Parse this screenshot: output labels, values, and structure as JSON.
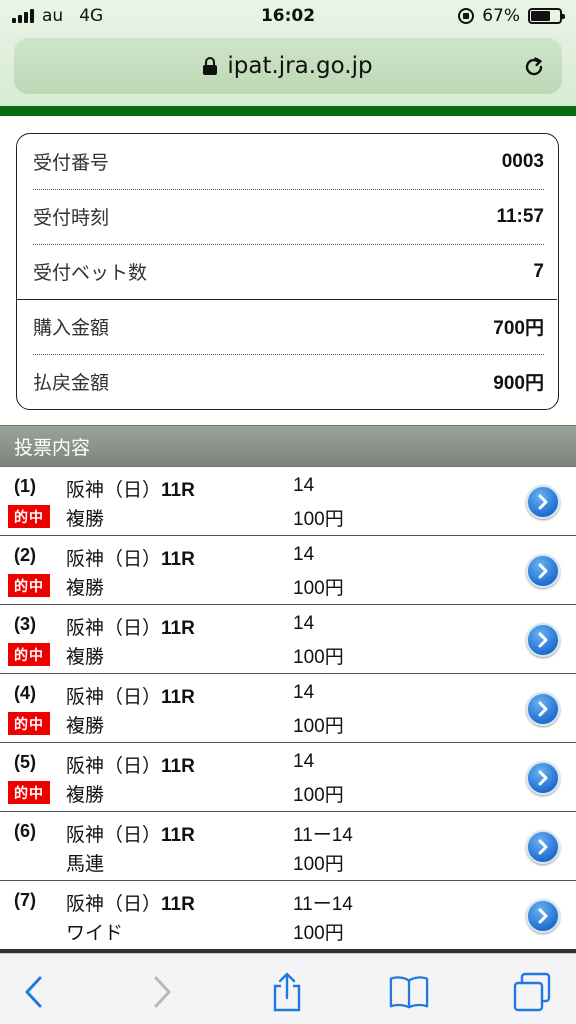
{
  "status": {
    "carrier": "au",
    "network": "4G",
    "time": "16:02",
    "battery": "67%",
    "battery_level": 0.67
  },
  "browser": {
    "url": "ipat.jra.go.jp"
  },
  "receipt": {
    "rows": [
      {
        "label": "受付番号",
        "value": "0003"
      },
      {
        "label": "受付時刻",
        "value": "11:57"
      },
      {
        "label": "受付ベット数",
        "value": "7"
      },
      {
        "label": "購入金額",
        "value": "700円"
      },
      {
        "label": "払戻金額",
        "value": "900円"
      }
    ]
  },
  "section": {
    "title": "投票内容"
  },
  "bets": [
    {
      "num": "(1)",
      "venue": "阪神（日）",
      "race": "11R",
      "type": "複勝",
      "horse": "14",
      "amount": "100円",
      "badge": "的中"
    },
    {
      "num": "(2)",
      "venue": "阪神（日）",
      "race": "11R",
      "type": "複勝",
      "horse": "14",
      "amount": "100円",
      "badge": "的中"
    },
    {
      "num": "(3)",
      "venue": "阪神（日）",
      "race": "11R",
      "type": "複勝",
      "horse": "14",
      "amount": "100円",
      "badge": "的中"
    },
    {
      "num": "(4)",
      "venue": "阪神（日）",
      "race": "11R",
      "type": "複勝",
      "horse": "14",
      "amount": "100円",
      "badge": "的中"
    },
    {
      "num": "(5)",
      "venue": "阪神（日）",
      "race": "11R",
      "type": "複勝",
      "horse": "14",
      "amount": "100円",
      "badge": "的中"
    },
    {
      "num": "(6)",
      "venue": "阪神（日）",
      "race": "11R",
      "type": "馬連",
      "horse": "11ー14",
      "amount": "100円",
      "badge": ""
    },
    {
      "num": "(7)",
      "venue": "阪神（日）",
      "race": "11R",
      "type": "ワイド",
      "horse": "11ー14",
      "amount": "100円",
      "badge": ""
    }
  ],
  "colors": {
    "accent_green": "#0b6a10",
    "hit_badge": "#ee0000",
    "ios_blue": "#1f7ae0"
  },
  "icons": {
    "back": "chevron-left-icon",
    "forward": "chevron-right-icon",
    "share": "share-icon",
    "bookmarks": "book-icon",
    "tabs": "tabs-icon",
    "reload": "reload-icon",
    "lock": "lock-icon",
    "row_action": "arrow-circle-right-icon"
  }
}
